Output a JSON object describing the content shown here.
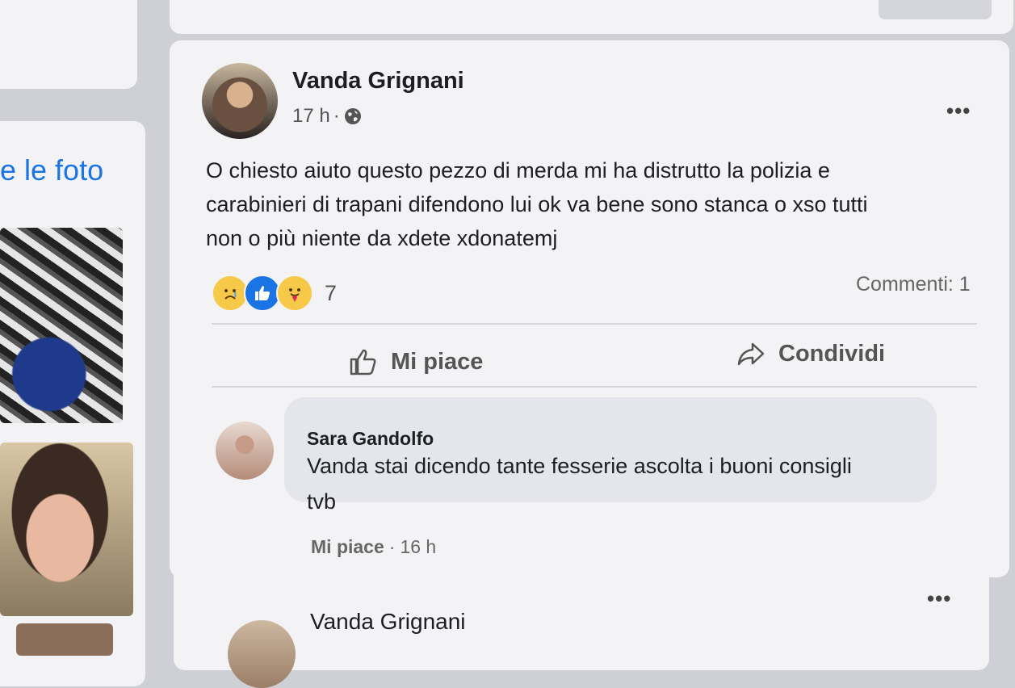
{
  "sidebar": {
    "photos_title": "e le foto"
  },
  "post": {
    "author": "Vanda Grignani",
    "time": "17 h",
    "separator": "·",
    "menu": "•••",
    "text_lines": [
      "O chiesto aiuto questo pezzo di merda mi ha distrutto la polizia e",
      "carabinieri di trapani difendono lui ok va bene sono stanca o xso tutti",
      "non o più niente da xdete xdonatemj"
    ],
    "reaction_count": "7",
    "comments_count": "Commenti: 1",
    "actions": {
      "like": "Mi piace",
      "share": "Condividi"
    },
    "reactions": [
      "sad-icon",
      "like-icon",
      "care-icon"
    ]
  },
  "comment": {
    "author": "Sara Gandolfo",
    "text_lines": [
      "Vanda stai dicendo tante fesserie ascolta i buoni consigli",
      "tvb"
    ],
    "like_label": "Mi piace",
    "separator": "·",
    "time": "16 h"
  },
  "next_post": {
    "author": "Vanda Grignani",
    "menu": "•••"
  },
  "colors": {
    "accent": "#1b74e4",
    "background": "#cfd0d5",
    "card": "#f3f3f5"
  }
}
